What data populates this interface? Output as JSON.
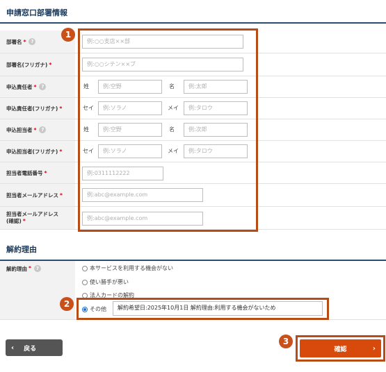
{
  "section1": {
    "title": "申請窓口部署情報"
  },
  "fields": {
    "dept_name": {
      "label": "部署名",
      "req": "*",
      "help": "?",
      "placeholder": "例:○○支店××部"
    },
    "dept_kana": {
      "label": "部署名(フリガナ)",
      "req": "*",
      "placeholder": "例:○○シテン××ブ"
    },
    "resp_name": {
      "label": "申込責任者",
      "req": "*",
      "help": "?",
      "sei_label": "姓",
      "mei_label": "名",
      "sei_placeholder": "例:空野",
      "mei_placeholder": "例:太郎"
    },
    "resp_kana": {
      "label": "申込責任者(フリガナ)",
      "req": "*",
      "sei_label": "セイ",
      "mei_label": "メイ",
      "sei_placeholder": "例:ソラノ",
      "mei_placeholder": "例:タロウ"
    },
    "contact_name": {
      "label": "申込担当者",
      "req": "*",
      "help": "?",
      "sei_label": "姓",
      "mei_label": "名",
      "sei_placeholder": "例:空野",
      "mei_placeholder": "例:次郎"
    },
    "contact_kana": {
      "label": "申込担当者(フリガナ)",
      "req": "*",
      "sei_label": "セイ",
      "mei_label": "メイ",
      "sei_placeholder": "例:ソラノ",
      "mei_placeholder": "例:タロウ"
    },
    "phone": {
      "label": "担当者電話番号",
      "req": "*",
      "placeholder": "例:0311112222"
    },
    "email": {
      "label": "担当者メールアドレス",
      "req": "*",
      "placeholder": "例:abc@example.com"
    },
    "email_confirm": {
      "label_line1": "担当者メールアドレス",
      "label_line2": "(確認)",
      "req": "*",
      "placeholder": "例:abc@example.com"
    }
  },
  "section2": {
    "title": "解約理由"
  },
  "reason": {
    "label": "解約理由",
    "req": "*",
    "help": "?",
    "options": [
      "本サービスを利用する機会がない",
      "使い勝手が悪い",
      "法人カードの解約",
      "その他"
    ],
    "selected_index": 3,
    "other_value": "解約希望日:2025年10月1日 解約理由:利用する機会がないため"
  },
  "badges": [
    "1",
    "2",
    "3"
  ],
  "buttons": {
    "back": "戻る",
    "confirm": "確認"
  },
  "colors": {
    "accent": "#d84a0b",
    "highlight": "#b84c16",
    "heading": "#1a3a5c"
  }
}
